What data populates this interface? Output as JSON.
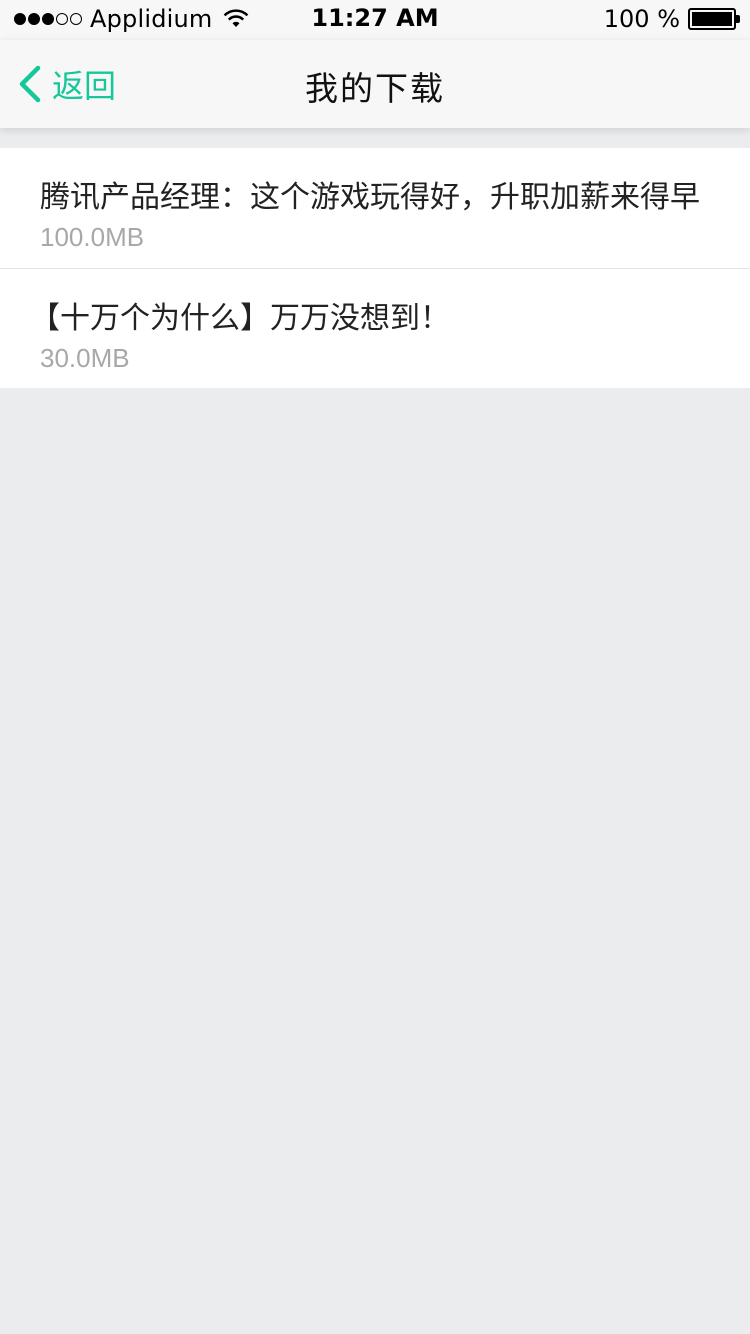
{
  "status_bar": {
    "carrier": "Applidium",
    "signal_full": 3,
    "signal_empty": 2,
    "time": "11:27 AM",
    "battery_text": "100 %",
    "battery_level": 1.0
  },
  "nav": {
    "back_label": "返回",
    "title": "我的下载",
    "accent_color": "#16c79a"
  },
  "downloads": [
    {
      "title": "腾讯产品经理：这个游戏玩得好，升职加薪来得早",
      "size": "100.0MB"
    },
    {
      "title": "【十万个为什么】万万没想到！",
      "size": "30.0MB"
    }
  ],
  "icons": {
    "back": "chevron-left-icon",
    "wifi": "wifi-icon",
    "battery": "battery-icon"
  }
}
